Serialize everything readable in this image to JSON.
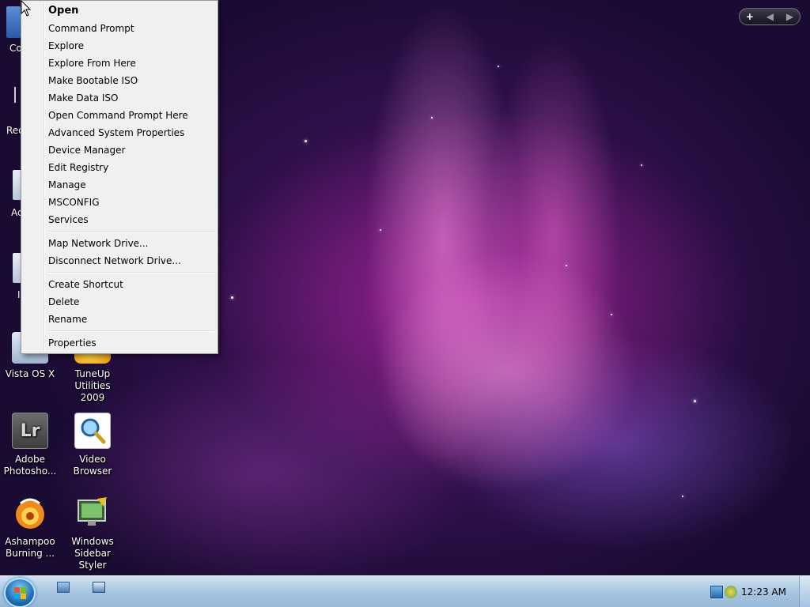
{
  "context_menu": {
    "items": [
      {
        "label": "Open",
        "bold": true
      },
      {
        "label": "Command Prompt"
      },
      {
        "label": "Explore"
      },
      {
        "label": "Explore From Here"
      },
      {
        "label": "Make Bootable ISO"
      },
      {
        "label": "Make Data ISO"
      },
      {
        "label": "Open Command Prompt Here"
      },
      {
        "label": "Advanced System Properties"
      },
      {
        "label": "Device Manager"
      },
      {
        "label": "Edit Registry"
      },
      {
        "label": "Manage"
      },
      {
        "label": "MSCONFIG"
      },
      {
        "label": "Services"
      },
      {
        "separator": true
      },
      {
        "label": "Map Network Drive..."
      },
      {
        "label": "Disconnect Network Drive..."
      },
      {
        "separator": true
      },
      {
        "label": "Create Shortcut"
      },
      {
        "label": "Delete"
      },
      {
        "label": "Rename"
      },
      {
        "separator": true
      },
      {
        "label": "Properties"
      }
    ]
  },
  "desktop": {
    "partial_labels": [
      "Co",
      "Rec",
      "Ac",
      "I"
    ],
    "icons": {
      "vista_osx": "Vista OS X",
      "tuneup_line1": "TuneUp",
      "tuneup_line2": "Utilities 2009",
      "lightroom_line1": "Adobe",
      "lightroom_line2": "Photosho...",
      "lightroom_glyph": "Lr",
      "video_line1": "Video",
      "video_line2": "Browser",
      "ashampoo_line1": "Ashampoo",
      "ashampoo_line2": "Burning ...",
      "sidebar_line1": "Windows",
      "sidebar_line2": "Sidebar Styler"
    }
  },
  "gadget_bar": {
    "add": "+",
    "prev": "◀",
    "next": "▶"
  },
  "taskbar": {
    "clock": "12:23 AM"
  },
  "colors": {
    "menu_bg": "#f0f0f0",
    "taskbar": "#a9c7e2"
  }
}
